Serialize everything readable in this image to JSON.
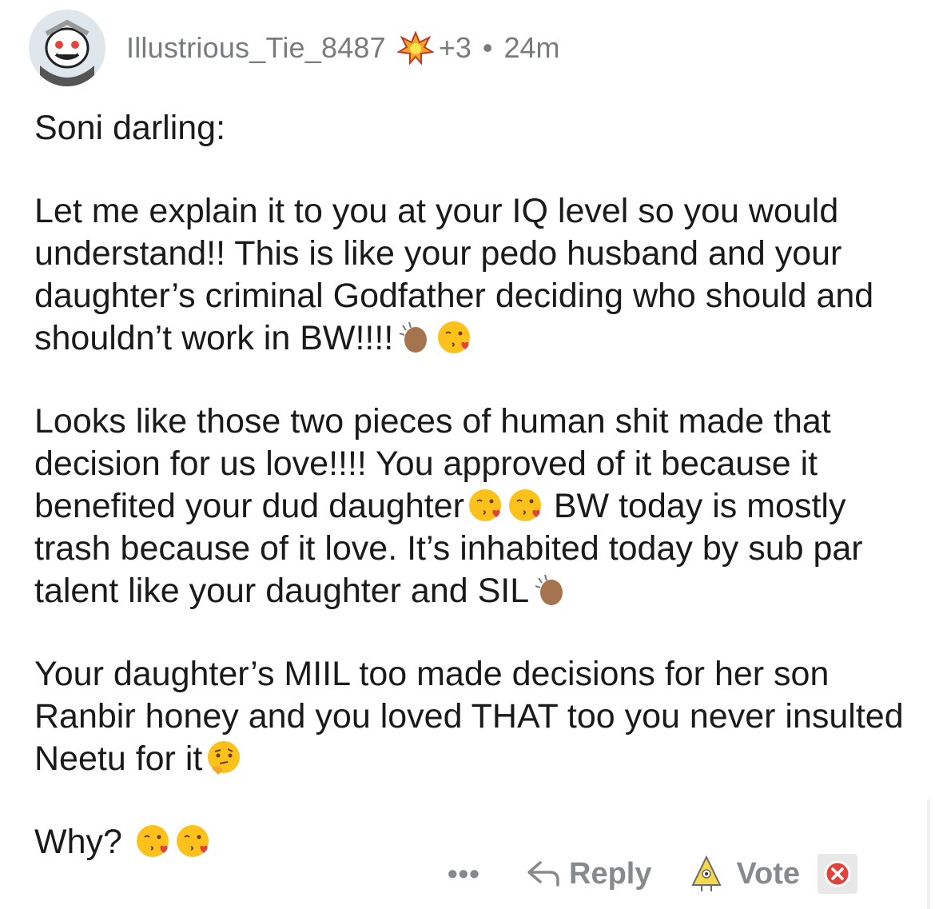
{
  "comment": {
    "author": "Illustrious_Tie_8487",
    "award_count": "+3",
    "separator": "•",
    "age": "24m",
    "paragraphs": [
      {
        "text": "Soni darling:",
        "emojis": []
      },
      {
        "text": "Let me explain it to you at your IQ level so you would understand!! This is like your pedo husband and your daughter’s criminal Godfather deciding who should and shouldn’t work in BW!!!!",
        "emojis": [
          "clapping-hands",
          "kiss-face"
        ]
      },
      {
        "text": "Looks like those two pieces of human shit made that decision for us love!!!! You approved of it because it benefited your dud daughter",
        "emojis": [
          "kiss-face",
          "kiss-face"
        ],
        "text_after": " BW today is mostly trash because of it love. It’s inhabited today by sub par talent like your daughter and SIL",
        "emojis_after": [
          "clapping-hands"
        ]
      },
      {
        "text": "Your daughter’s MIIL too made decisions for her son Ranbir honey and you loved THAT too you never insulted Neetu for it",
        "emojis": [
          "thinking-face"
        ]
      },
      {
        "text": "Why? ",
        "emojis": [
          "kiss-face",
          "kiss-face"
        ]
      }
    ]
  },
  "actions": {
    "more": "•••",
    "reply": "Reply",
    "vote": "Vote"
  },
  "icons": {
    "avatar": "snoo-avatar-icon",
    "award": "award-icon",
    "reply": "reply-arrow-icon",
    "upvote": "upvote-award-icon",
    "downvote": "downvote-icon"
  },
  "colors": {
    "meta_gray": "#787c7e",
    "text": "#1a1a1b",
    "downvote_red": "#e0443a"
  }
}
